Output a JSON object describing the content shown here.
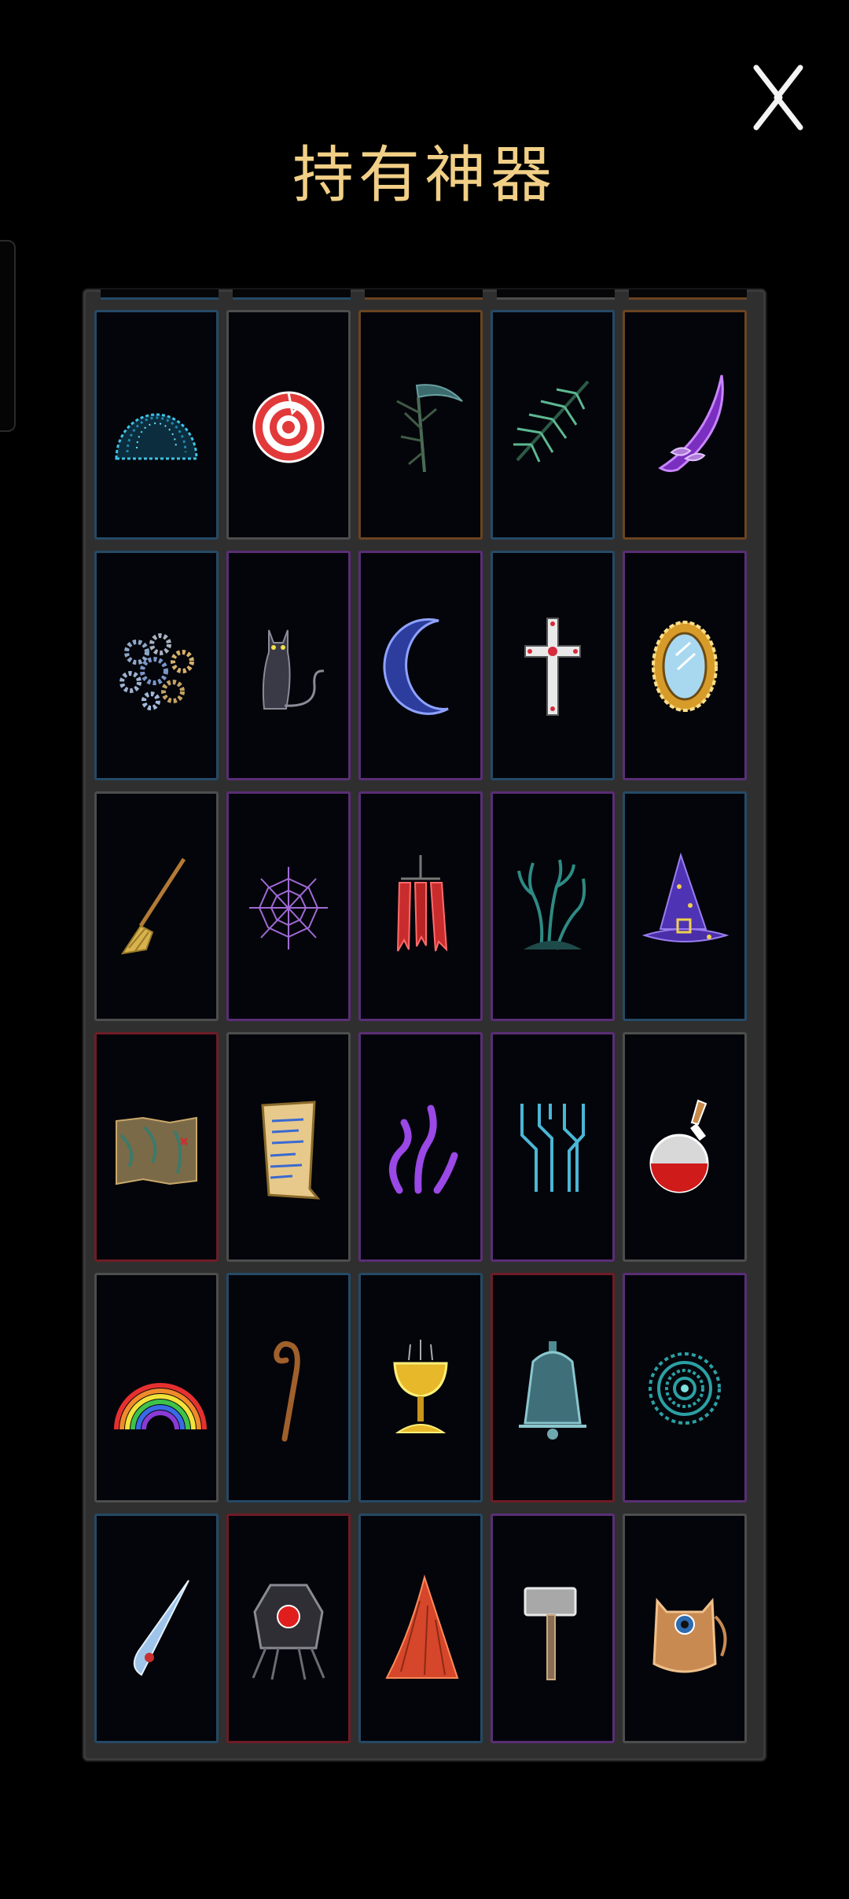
{
  "header": {
    "title": "持有神器"
  },
  "colors": {
    "title": "#f1cf86",
    "border_blue": "#254a66",
    "border_gray": "#4d4d4d",
    "border_orange": "#6a4420",
    "border_purple": "#5a2e76",
    "border_red": "#6e1c26"
  },
  "artifacts": [
    {
      "icon": "dark-orb-icon",
      "border": "blue"
    },
    {
      "icon": "target-icon",
      "border": "gray"
    },
    {
      "icon": "scythe-icon",
      "border": "orange"
    },
    {
      "icon": "fir-branch-icon",
      "border": "blue"
    },
    {
      "icon": "purple-claw-icon",
      "border": "orange"
    },
    {
      "icon": "gears-icon",
      "border": "blue"
    },
    {
      "icon": "black-cat-icon",
      "border": "purple"
    },
    {
      "icon": "crescent-moon-icon",
      "border": "purple"
    },
    {
      "icon": "jeweled-cross-icon",
      "border": "blue"
    },
    {
      "icon": "golden-mirror-icon",
      "border": "purple"
    },
    {
      "icon": "broom-icon",
      "border": "gray"
    },
    {
      "icon": "spider-web-icon",
      "border": "purple"
    },
    {
      "icon": "red-banners-icon",
      "border": "purple"
    },
    {
      "icon": "dead-tree-icon",
      "border": "purple"
    },
    {
      "icon": "wizard-hat-icon",
      "border": "blue"
    },
    {
      "icon": "treasure-map-icon",
      "border": "red"
    },
    {
      "icon": "scroll-icon",
      "border": "gray"
    },
    {
      "icon": "tentacles-icon",
      "border": "purple"
    },
    {
      "icon": "circuit-glyph-icon",
      "border": "purple"
    },
    {
      "icon": "red-potion-icon",
      "border": "gray"
    },
    {
      "icon": "rainbow-icon",
      "border": "gray"
    },
    {
      "icon": "wooden-staff-icon",
      "border": "blue"
    },
    {
      "icon": "golden-chalice-icon",
      "border": "blue"
    },
    {
      "icon": "bell-icon",
      "border": "red"
    },
    {
      "icon": "spiral-portal-icon",
      "border": "purple"
    },
    {
      "icon": "spike-shard-icon",
      "border": "blue"
    },
    {
      "icon": "mechanical-eye-icon",
      "border": "red"
    },
    {
      "icon": "red-fin-icon",
      "border": "blue"
    },
    {
      "icon": "war-hammer-icon",
      "border": "purple"
    },
    {
      "icon": "cat-bag-icon",
      "border": "gray"
    }
  ]
}
